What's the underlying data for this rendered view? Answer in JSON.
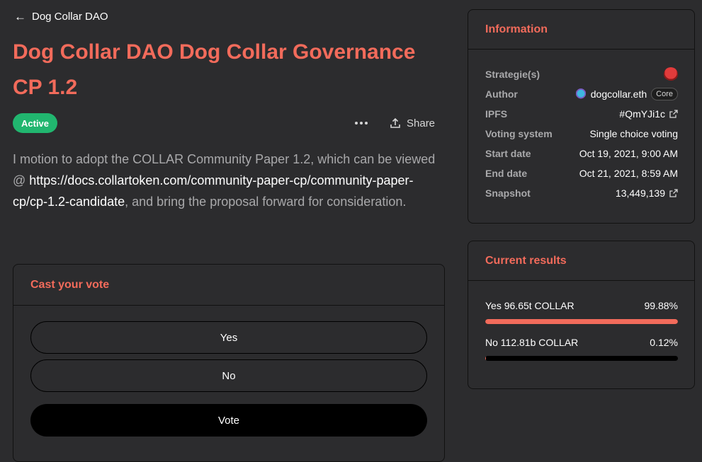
{
  "nav": {
    "back_label": "Dog Collar DAO"
  },
  "proposal": {
    "title": "Dog Collar DAO Dog Collar Governance CP 1.2",
    "status": "Active",
    "share_label": "Share",
    "body_before": "I motion to adopt the COLLAR Community Paper 1.2, which can be viewed @ ",
    "body_link": "https://docs.collartoken.com/community-paper-cp/community-paper-cp/cp-1.2-candidate",
    "body_after": ", and bring the proposal forward for consideration."
  },
  "vote": {
    "heading": "Cast your vote",
    "choices": [
      "Yes",
      "No"
    ],
    "submit_label": "Vote"
  },
  "information": {
    "heading": "Information",
    "strategies_label": "Strategie(s)",
    "author_label": "Author",
    "author_value": "dogcollar.eth",
    "author_badge": "Core",
    "ipfs_label": "IPFS",
    "ipfs_value": "#QmYJi1c",
    "voting_system_label": "Voting system",
    "voting_system_value": "Single choice voting",
    "start_label": "Start date",
    "start_value": "Oct 19, 2021, 9:00 AM",
    "end_label": "End date",
    "end_value": "Oct 21, 2021, 8:59 AM",
    "snapshot_label": "Snapshot",
    "snapshot_value": "13,449,139"
  },
  "results": {
    "heading": "Current results",
    "items": [
      {
        "label": "Yes 96.65t COLLAR",
        "percent": "99.88%",
        "fraction": 0.9988
      },
      {
        "label": "No 112.81b COLLAR",
        "percent": "0.12%",
        "fraction": 0.0012
      }
    ]
  },
  "colors": {
    "accent": "#f26b5b",
    "active": "#21b66f",
    "background": "#2c2c2e"
  }
}
